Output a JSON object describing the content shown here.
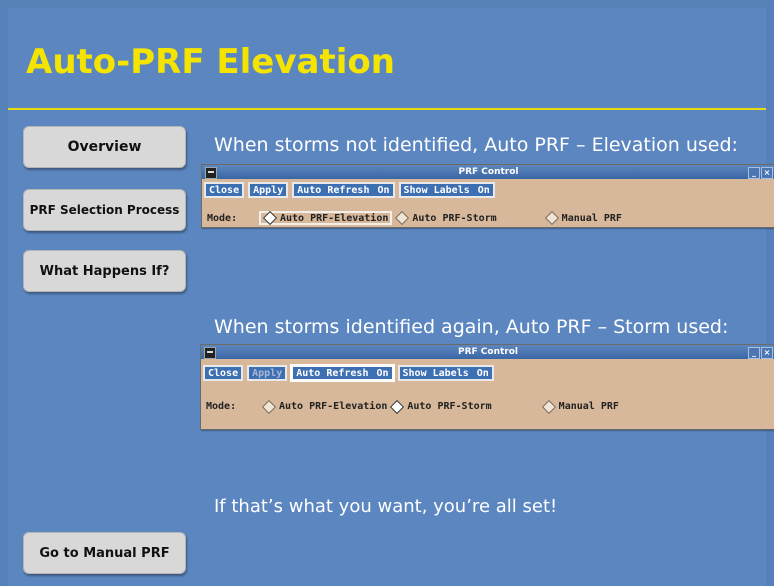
{
  "slide": {
    "title": "Auto-PRF Elevation",
    "caption_1": "When storms not identified, Auto PRF – Elevation used:",
    "caption_2": "When storms identified again, Auto PRF – Storm used:",
    "footer_text": "If that’s what you want, you’re all set!"
  },
  "nav": {
    "overview": "Overview",
    "prf_selection": "PRF Selection Process",
    "what_happens": "What Happens If?",
    "manual": "Go to Manual PRF"
  },
  "window_1": {
    "title": "PRF Control",
    "btn_close": "Close",
    "btn_apply": "Apply",
    "btn_auto_refresh": "Auto Refresh",
    "auto_refresh_state": "On",
    "btn_show_labels": "Show Labels",
    "show_labels_state": "On",
    "mode_label": "Mode:",
    "opt_elevation": "Auto PRF-Elevation",
    "opt_storm": "Auto PRF-Storm",
    "opt_manual": "Manual PRF",
    "selected": "Auto PRF-Elevation"
  },
  "window_2": {
    "title": "PRF Control",
    "btn_close": "Close",
    "btn_apply": "Apply",
    "btn_auto_refresh": "Auto Refresh",
    "auto_refresh_state": "On",
    "btn_show_labels": "Show Labels",
    "show_labels_state": "On",
    "mode_label": "Mode:",
    "opt_elevation": "Auto PRF-Elevation",
    "opt_storm": "Auto PRF-Storm",
    "opt_manual": "Manual PRF",
    "selected": "Auto PRF-Storm"
  },
  "colors": {
    "background": "#5b86c0",
    "title": "#f5e400",
    "window_body": "#d7b89a",
    "button": "#3d6fb3"
  }
}
